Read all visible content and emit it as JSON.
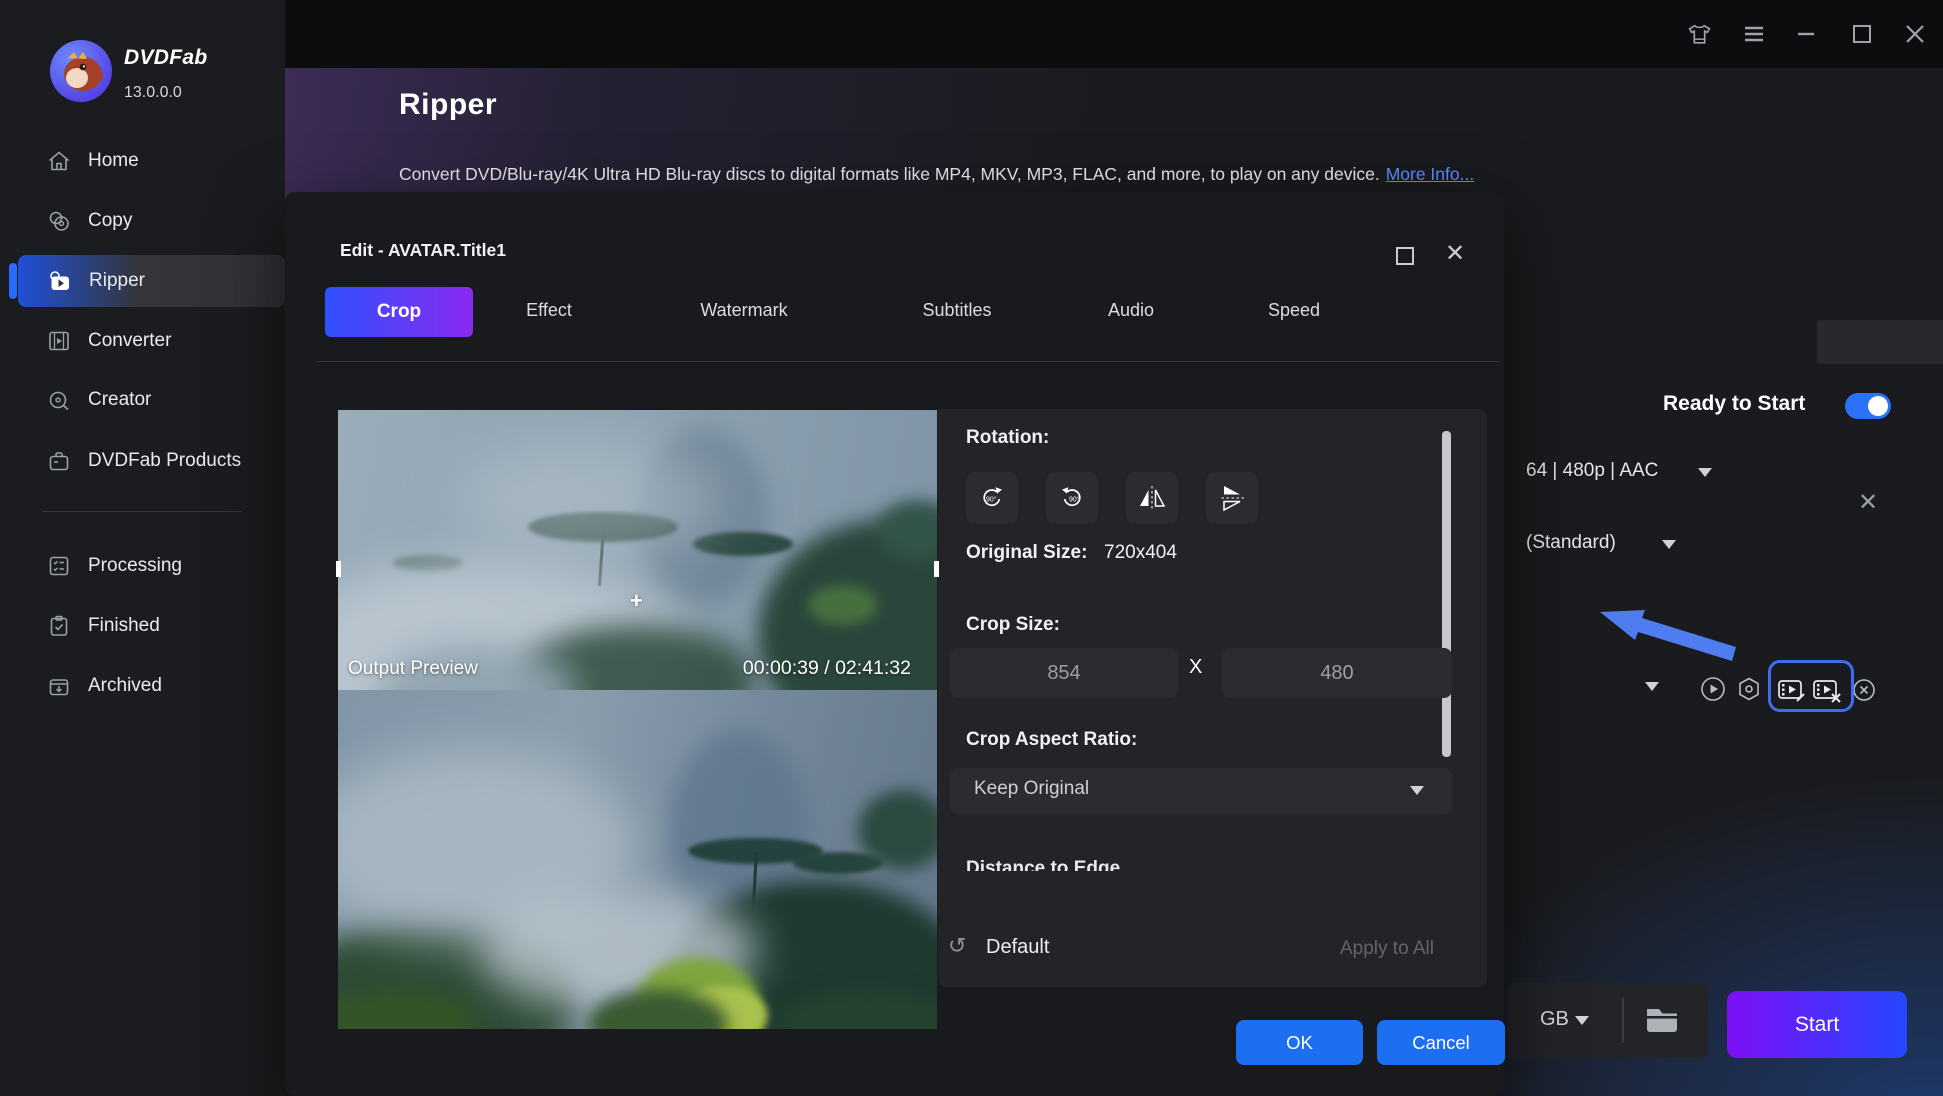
{
  "app": {
    "name": "DVDFab",
    "version": "13.0.0.0"
  },
  "titlebar": {
    "icons": [
      "theme-icon",
      "menu-icon",
      "minimize-icon",
      "maximize-icon",
      "close-icon"
    ]
  },
  "sidebar": {
    "items": [
      {
        "label": "Home",
        "icon": "home-icon",
        "active": false
      },
      {
        "label": "Copy",
        "icon": "copy-icon",
        "active": false
      },
      {
        "label": "Ripper",
        "icon": "ripper-icon",
        "active": true
      },
      {
        "label": "Converter",
        "icon": "converter-icon",
        "active": false
      },
      {
        "label": "Creator",
        "icon": "creator-icon",
        "active": false
      },
      {
        "label": "DVDFab Products",
        "icon": "products-icon",
        "active": false
      },
      {
        "label": "Processing",
        "icon": "processing-icon",
        "active": false
      },
      {
        "label": "Finished",
        "icon": "finished-icon",
        "active": false
      },
      {
        "label": "Archived",
        "icon": "archived-icon",
        "active": false
      }
    ]
  },
  "header": {
    "title": "Ripper",
    "description": "Convert DVD/Blu-ray/4K Ultra HD Blu-ray discs to digital formats like MP4, MKV, MP3, FLAC, and more, to play on any device.",
    "more_info": "More Info..."
  },
  "task_panel": {
    "ready_label": "Ready to Start",
    "toggle_on": true,
    "format_text": "64 | 480p | AAC",
    "quality_text": "(Standard)"
  },
  "bottom_bar": {
    "size_unit": "GB",
    "start_label": "Start"
  },
  "modal": {
    "title": "Edit - AVATAR.Title1",
    "tabs": [
      {
        "label": "Crop",
        "active": true
      },
      {
        "label": "Effect",
        "active": false
      },
      {
        "label": "Watermark",
        "active": false
      },
      {
        "label": "Subtitles",
        "active": false
      },
      {
        "label": "Audio",
        "active": false
      },
      {
        "label": "Speed",
        "active": false
      }
    ],
    "preview": {
      "label": "Output Preview",
      "timecode": "00:00:39 / 02:41:32",
      "crosshair": "+"
    },
    "crop": {
      "rotation_label": "Rotation:",
      "original_size_label": "Original Size:",
      "original_size_value": "720x404",
      "crop_size_label": "Crop Size:",
      "crop_width": "854",
      "separator": "X",
      "crop_height": "480",
      "aspect_label": "Crop Aspect Ratio:",
      "aspect_value": "Keep Original",
      "clipped_heading": "Distance to Edge",
      "default_label": "Default",
      "apply_all_label": "Apply to All"
    },
    "ok_label": "OK",
    "cancel_label": "Cancel"
  },
  "colors": {
    "accent_blue": "#1d6ff2",
    "toggle_on": "#2b72f8",
    "tab_gradient": [
      "#3050ff",
      "#8a2af0"
    ],
    "start_gradient": [
      "#7e0ff5",
      "#2647ff"
    ],
    "link": "#5b8cff",
    "annotation": "#4f7df0"
  }
}
